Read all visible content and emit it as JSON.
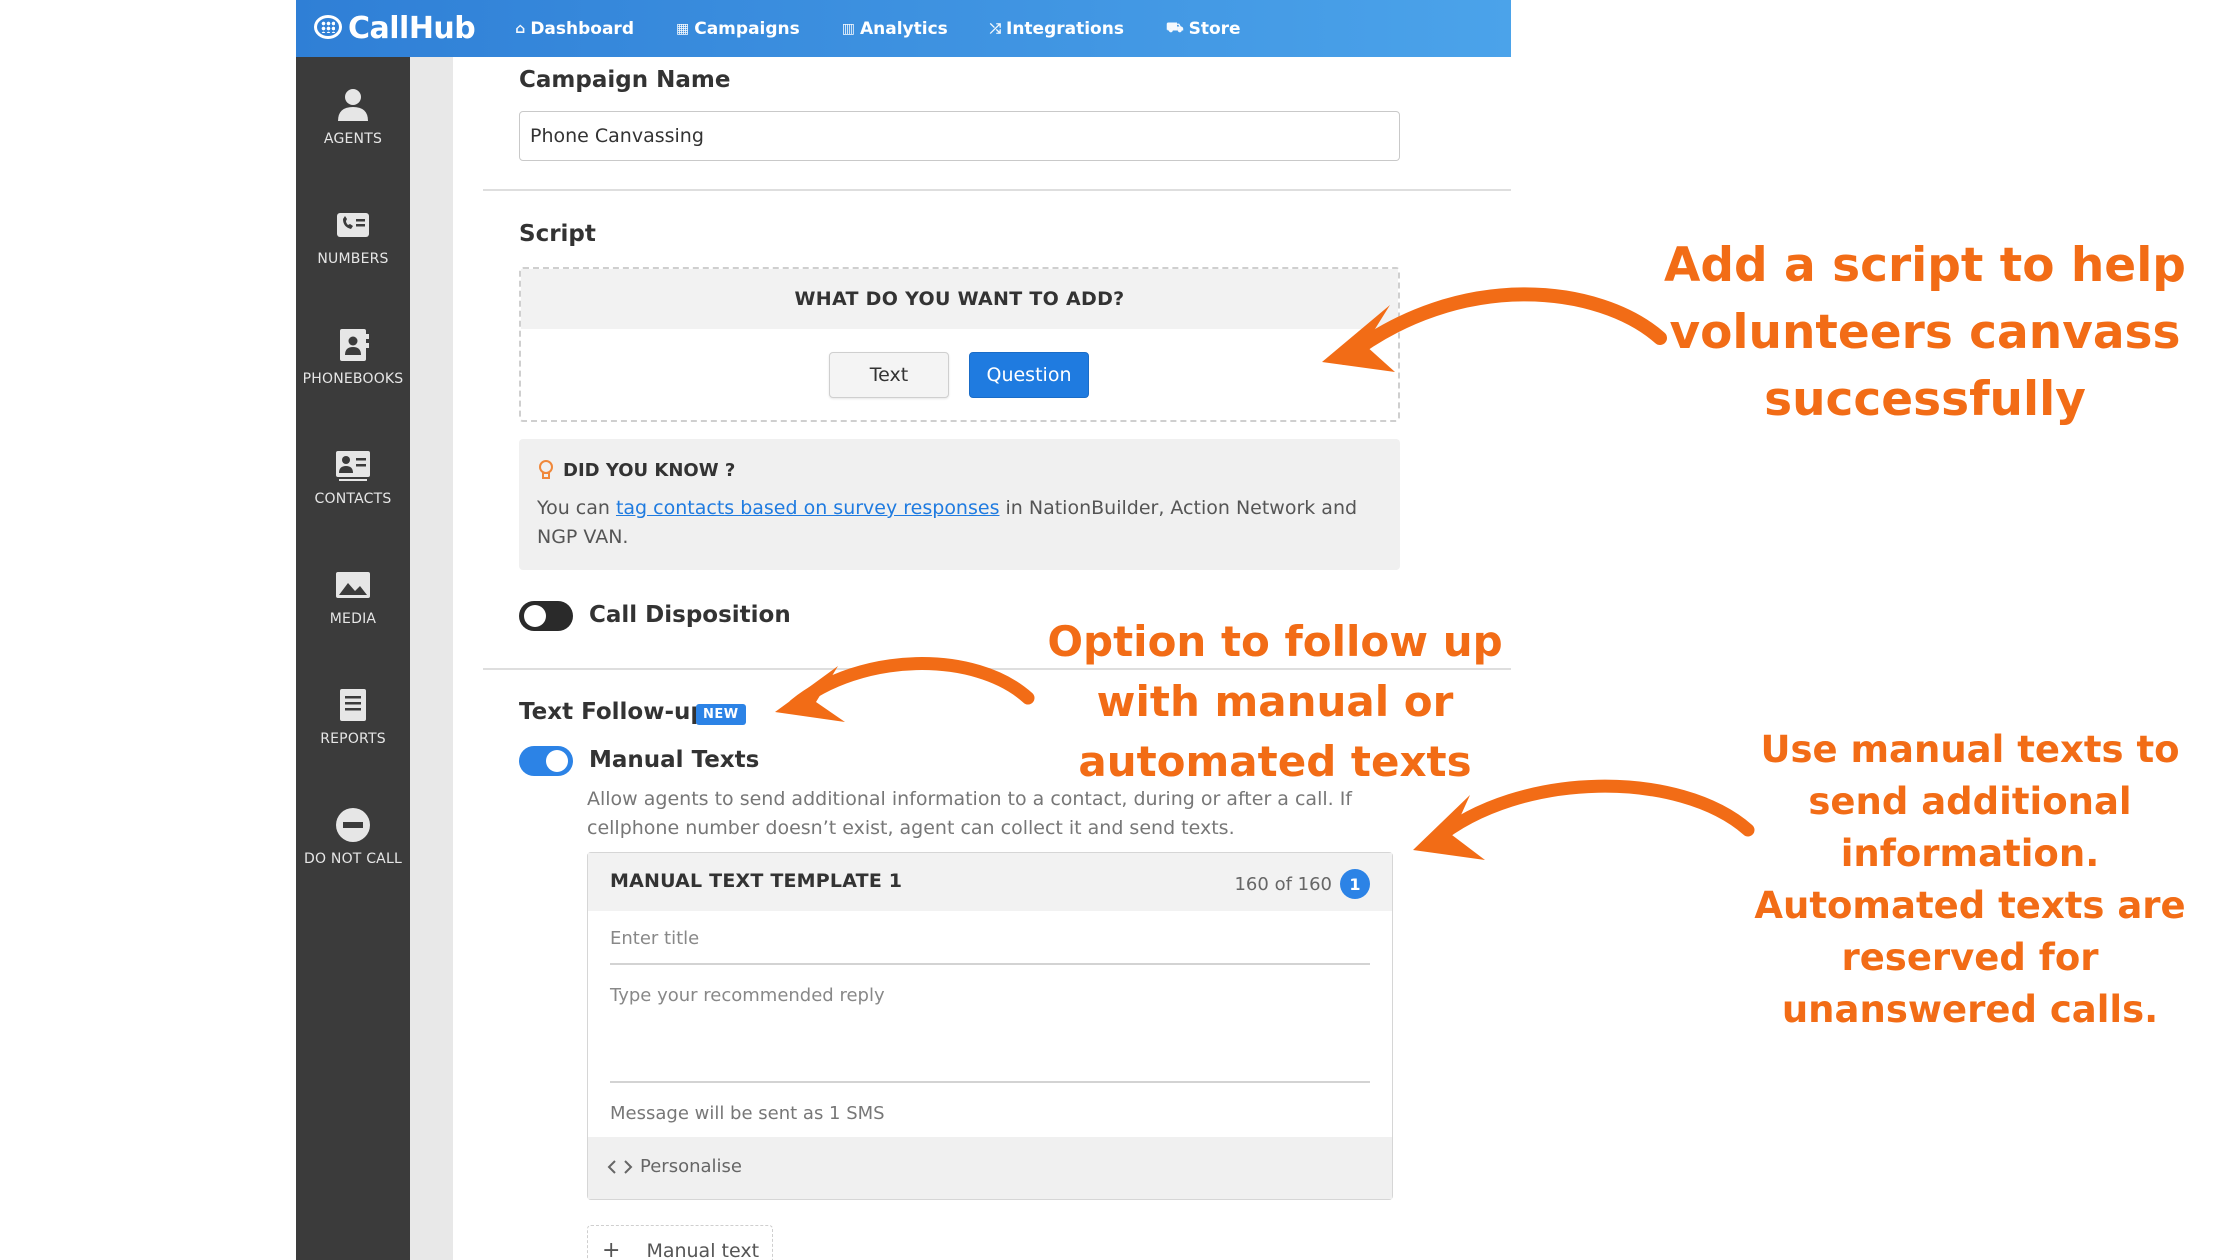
{
  "app": {
    "name": "CallHub"
  },
  "nav": [
    {
      "icon": "home-icon",
      "label": "Dashboard",
      "glyph": "⌂"
    },
    {
      "icon": "campaigns-grid-icon",
      "label": "Campaigns",
      "glyph": "▦"
    },
    {
      "icon": "analytics-chart-icon",
      "label": "Analytics",
      "glyph": "▥"
    },
    {
      "icon": "shuffle-icon",
      "label": "Integrations",
      "glyph": "⤮"
    },
    {
      "icon": "cart-icon",
      "label": "Store",
      "glyph": "⛟"
    }
  ],
  "sidebar": [
    {
      "icon": "person-icon",
      "label": "AGENTS"
    },
    {
      "icon": "phone-card-icon",
      "label": "NUMBERS"
    },
    {
      "icon": "phonebook-icon",
      "label": "PHONEBOOKS"
    },
    {
      "icon": "contact-card-icon",
      "label": "CONTACTS"
    },
    {
      "icon": "image-icon",
      "label": "MEDIA"
    },
    {
      "icon": "report-icon",
      "label": "REPORTS"
    },
    {
      "icon": "minus-circle-icon",
      "label": "DO NOT CALL"
    }
  ],
  "campaign": {
    "name_label": "Campaign Name",
    "name_value": "Phone Canvassing"
  },
  "script": {
    "label": "Script",
    "prompt": "WHAT DO YOU WANT TO ADD?",
    "text_button": "Text",
    "question_button": "Question"
  },
  "did_you_know": {
    "title": "DID YOU KNOW ?",
    "prefix": "You can ",
    "link": "tag contacts based on survey responses",
    "suffix": " in NationBuilder, Action Network and NGP VAN."
  },
  "call_disposition": {
    "label": "Call Disposition",
    "enabled": false
  },
  "text_followup": {
    "label": "Text Follow-up",
    "badge": "NEW",
    "manual_label": "Manual Texts",
    "manual_enabled": true,
    "help": "Allow agents to send additional information to a contact, during or after a call. If cellphone number doesn’t exist, agent can collect it and send texts."
  },
  "template": {
    "title": "MANUAL TEXT TEMPLATE 1",
    "count": "160 of 160",
    "number": "1",
    "title_placeholder": "Enter title",
    "reply_placeholder": "Type your recommended reply",
    "sms_note": "Message will be sent as 1 SMS",
    "personalise": "Personalise"
  },
  "add_manual_text": {
    "plus": "+",
    "label": "Manual text"
  },
  "annotations": {
    "script_note": "Add a script to help volunteers canvass successfully",
    "followup_note": "Option to follow up with manual or automated texts",
    "manual_note": "Use manual texts to send additional information. Automated texts are reserved for unanswered calls."
  },
  "colors": {
    "topbar": "#2f7fd6",
    "sidebar": "#3b3b3b",
    "accent": "#2c83e6",
    "annotation": "#f26c16"
  }
}
